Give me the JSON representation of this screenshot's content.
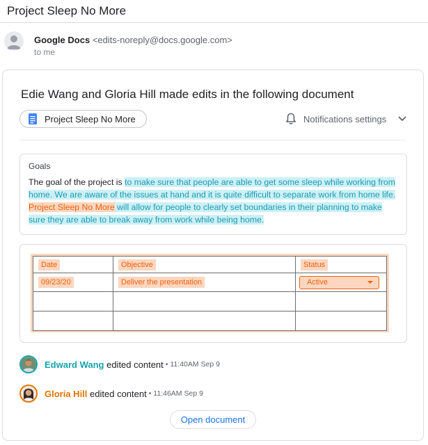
{
  "email": {
    "subject": "Project Sleep No More",
    "sender_name": "Google Docs",
    "sender_email": "<edits-noreply@docs.google.com>",
    "recipient": "to me"
  },
  "card": {
    "headline": "Edie Wang and Gloria Hill made edits in the following document",
    "doc_chip_label": "Project Sleep No More",
    "doc_icon": "google-docs-icon",
    "notifications_label": "Notifications settings",
    "notifications_icon": "bell-icon",
    "dropdown_icon": "chevron-down-icon"
  },
  "goals": {
    "title": "Goals",
    "text_plain_1": "The goal of the project is ",
    "text_blue_1": "to make sure that people are able to get some sleep while working from home. We are aware of the issues at hand and it is quite difficult to separate work from home life.",
    "text_orange": "Project Sleep No More",
    "text_blue_2": " will allow for people to clearly set boundaries in their planning to make sure they are able to break away from work while being home."
  },
  "table": {
    "headers": [
      "Date",
      "Objective",
      "Status"
    ],
    "rows": [
      {
        "date": "09/23/20",
        "objective": "Deliver the presentation",
        "status": "Active"
      }
    ]
  },
  "editors": [
    {
      "name": "Edward Wang",
      "action": "edited content",
      "time": "• 11:40AM Sep 9",
      "color": "#12a4af"
    },
    {
      "name": "Gloria Hill",
      "action": "edited content",
      "time": "• 11:46AM Sep 9",
      "color": "#e37400"
    }
  ],
  "colors": {
    "highlight_blue": "#ccf0f5",
    "highlight_orange": "#fdd6bf",
    "link_blue": "#1a73e8"
  },
  "open_button_label": "Open document"
}
